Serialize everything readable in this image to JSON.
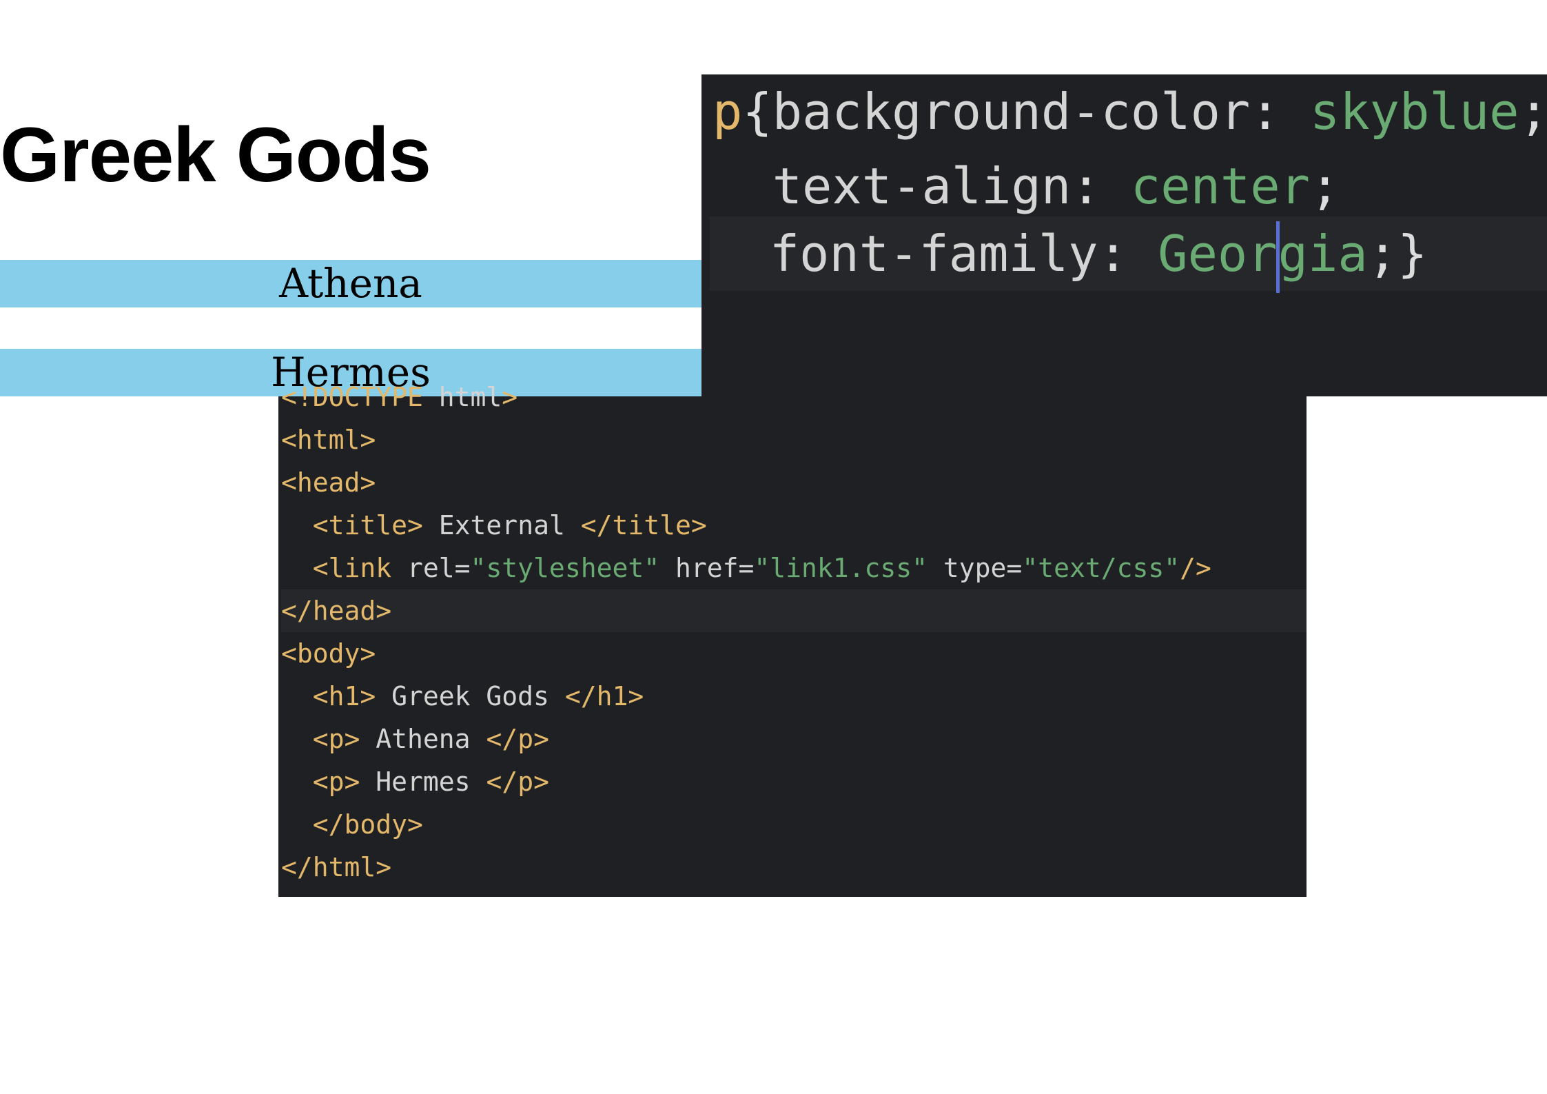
{
  "preview": {
    "heading": "Greek Gods",
    "paragraphs": [
      "Athena",
      "Hermes"
    ]
  },
  "css_editor": {
    "lines": [
      {
        "sel": "p",
        "brace_open": "{",
        "prop": "background-color",
        "colon": ": ",
        "val": "skyblue",
        "end": ";"
      },
      {
        "indent": "  ",
        "prop": "text-align",
        "colon": ": ",
        "val": "center",
        "end": ";"
      },
      {
        "indent": "  ",
        "prop": "font-family",
        "colon": ": ",
        "val_a": "Geor",
        "val_b": "gia",
        "end": ";}"
      }
    ]
  },
  "html_editor": {
    "lines": [
      {
        "tag": "<!DOCTYPE",
        "txt": " html",
        "tag2": ">"
      },
      {
        "tag": "<html>"
      },
      {
        "tag": "<head>"
      },
      {
        "indent": "  ",
        "tag": "<title>",
        "txt": " External ",
        "tag2": "</title>"
      },
      {
        "indent": "  ",
        "tag": "<link",
        "a1": " rel=",
        "s1": "\"stylesheet\"",
        "a2": " href=",
        "s2": "\"link1.css\"",
        "a3": " type=",
        "s3": "\"text/css\"",
        "tag2": "/>"
      },
      {
        "tag": "</head>"
      },
      {
        "tag": "<body>"
      },
      {
        "indent": "  ",
        "tag": "<h1>",
        "txt": " Greek Gods ",
        "tag2": "</h1>"
      },
      {
        "indent": "  ",
        "tag": "<p>",
        "txt": " Athena ",
        "tag2": "</p>"
      },
      {
        "indent": "  ",
        "tag": "<p>",
        "txt": " Hermes ",
        "tag2": "</p>"
      },
      {
        "indent": "  ",
        "tag": "</body>"
      },
      {
        "tag": "</html>"
      }
    ]
  },
  "colors": {
    "skyblue": "#87ceeb",
    "editor_bg": "#1f2023",
    "tag": "#e3b86a",
    "string": "#6aab73",
    "caret": "#5a6fd6"
  }
}
